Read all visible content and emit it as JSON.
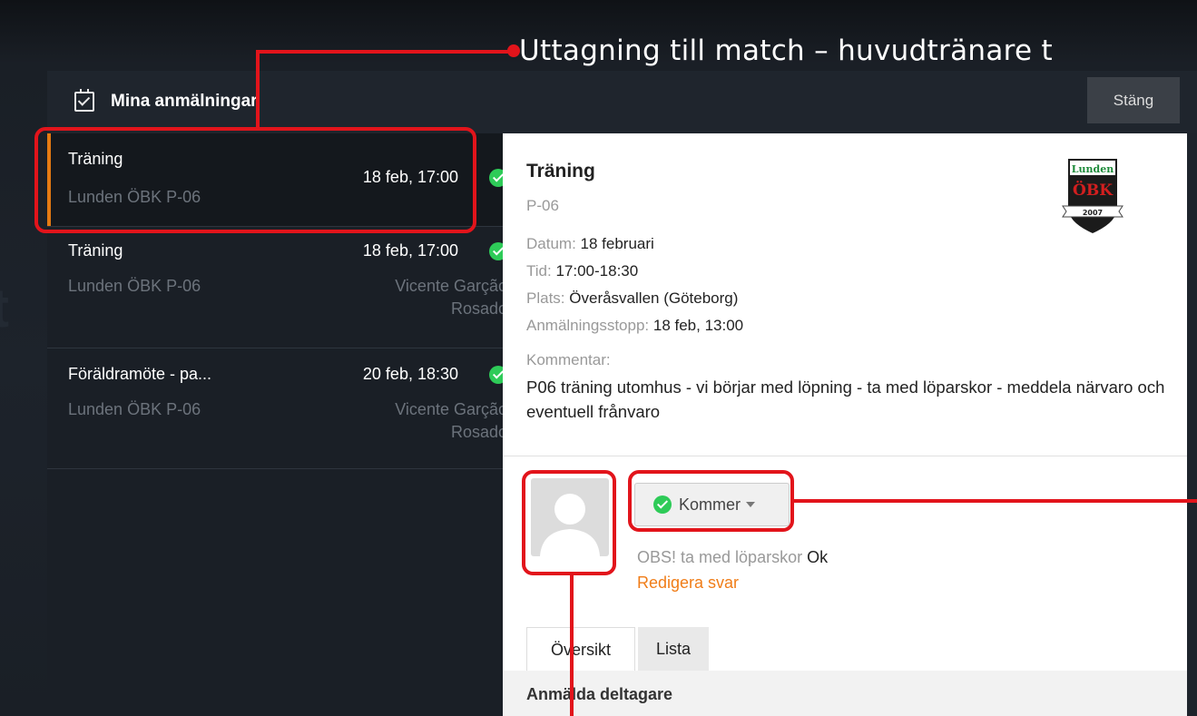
{
  "caption": "Uttagning till match – huvudtränare t",
  "header": {
    "title": "Mina anmälningar",
    "close_label": "Stäng"
  },
  "list": [
    {
      "title": "Träning",
      "team": "Lunden ÖBK P-06",
      "date": "18 feb, 17:00",
      "person": ""
    },
    {
      "title": "Träning",
      "team": "Lunden ÖBK P-06",
      "date": "18 feb, 17:00",
      "person": "Vicente Garção Rosado"
    },
    {
      "title": "Föräldramöte - pa...",
      "team": "Lunden ÖBK P-06",
      "date": "20 feb, 18:30",
      "person": "Vicente Garção Rosado"
    }
  ],
  "detail": {
    "title": "Träning",
    "team": "P-06",
    "logo_text": "Lunden ÖBK 2007",
    "date_label": "Datum:",
    "date_value": "18 februari",
    "time_label": "Tid:",
    "time_value": "17:00-18:30",
    "place_label": "Plats:",
    "place_value": "Överåsvallen (Göteborg)",
    "stop_label": "Anmälningsstopp:",
    "stop_value": "18 feb, 13:00",
    "comment_label": "Kommentar:",
    "comment": "P06 träning utomhus - vi börjar med löpning - ta med löparskor - meddela närvaro och eventuell frånvaro",
    "status": "Kommer",
    "note_question": "OBS! ta med löparskor",
    "note_answer": "Ok",
    "edit_label": "Redigera svar",
    "tabs": [
      "Översikt",
      "Lista"
    ],
    "section_title": "Anmälda deltagare"
  },
  "colors": {
    "accent": "#e57a12",
    "highlight": "#e2141b",
    "success": "#2ecb58"
  }
}
